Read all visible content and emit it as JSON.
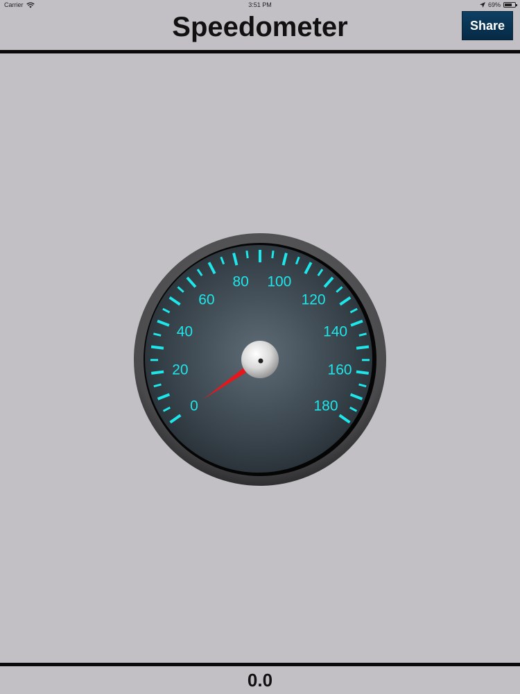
{
  "status_bar": {
    "carrier": "Carrier",
    "time": "3:51 PM",
    "battery_text": "69%",
    "battery_level": 0.69,
    "icons": [
      "wifi-icon",
      "location-icon",
      "battery-icon"
    ]
  },
  "nav": {
    "title": "Speedometer",
    "share_label": "Share"
  },
  "gauge": {
    "min": 0,
    "max": 180,
    "value": 0.0,
    "labels": [
      "0",
      "20",
      "40",
      "60",
      "80",
      "100",
      "120",
      "140",
      "160",
      "180"
    ],
    "tick_color": "#1ee6ea",
    "needle_color": "#e8161a",
    "face_color": "#3f4a52",
    "bezel_color": "#4a4a4c"
  },
  "readout": {
    "speed_text": "0.0"
  },
  "colors": {
    "background": "#c2c0c4",
    "share_button": "#0b3656",
    "rule": "#0a0a0a"
  }
}
